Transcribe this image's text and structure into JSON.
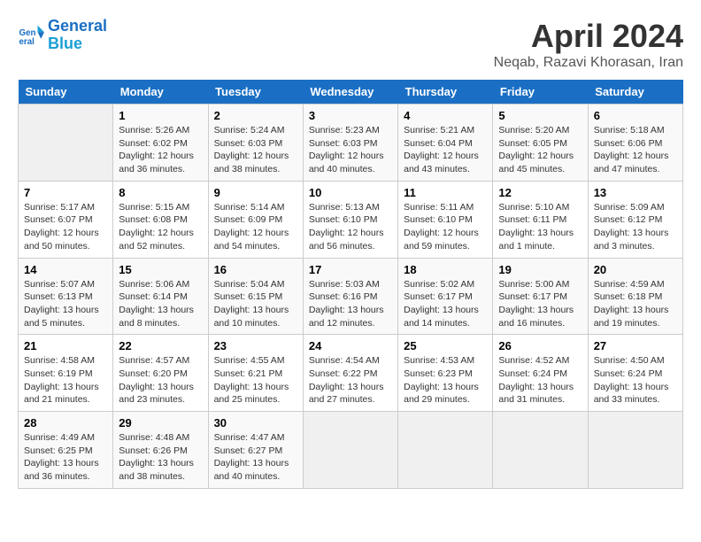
{
  "header": {
    "logo_line1": "General",
    "logo_line2": "Blue",
    "title": "April 2024",
    "subtitle": "Neqab, Razavi Khorasan, Iran"
  },
  "weekdays": [
    "Sunday",
    "Monday",
    "Tuesday",
    "Wednesday",
    "Thursday",
    "Friday",
    "Saturday"
  ],
  "weeks": [
    [
      {
        "day": "",
        "info": ""
      },
      {
        "day": "1",
        "info": "Sunrise: 5:26 AM\nSunset: 6:02 PM\nDaylight: 12 hours\nand 36 minutes."
      },
      {
        "day": "2",
        "info": "Sunrise: 5:24 AM\nSunset: 6:03 PM\nDaylight: 12 hours\nand 38 minutes."
      },
      {
        "day": "3",
        "info": "Sunrise: 5:23 AM\nSunset: 6:03 PM\nDaylight: 12 hours\nand 40 minutes."
      },
      {
        "day": "4",
        "info": "Sunrise: 5:21 AM\nSunset: 6:04 PM\nDaylight: 12 hours\nand 43 minutes."
      },
      {
        "day": "5",
        "info": "Sunrise: 5:20 AM\nSunset: 6:05 PM\nDaylight: 12 hours\nand 45 minutes."
      },
      {
        "day": "6",
        "info": "Sunrise: 5:18 AM\nSunset: 6:06 PM\nDaylight: 12 hours\nand 47 minutes."
      }
    ],
    [
      {
        "day": "7",
        "info": "Sunrise: 5:17 AM\nSunset: 6:07 PM\nDaylight: 12 hours\nand 50 minutes."
      },
      {
        "day": "8",
        "info": "Sunrise: 5:15 AM\nSunset: 6:08 PM\nDaylight: 12 hours\nand 52 minutes."
      },
      {
        "day": "9",
        "info": "Sunrise: 5:14 AM\nSunset: 6:09 PM\nDaylight: 12 hours\nand 54 minutes."
      },
      {
        "day": "10",
        "info": "Sunrise: 5:13 AM\nSunset: 6:10 PM\nDaylight: 12 hours\nand 56 minutes."
      },
      {
        "day": "11",
        "info": "Sunrise: 5:11 AM\nSunset: 6:10 PM\nDaylight: 12 hours\nand 59 minutes."
      },
      {
        "day": "12",
        "info": "Sunrise: 5:10 AM\nSunset: 6:11 PM\nDaylight: 13 hours\nand 1 minute."
      },
      {
        "day": "13",
        "info": "Sunrise: 5:09 AM\nSunset: 6:12 PM\nDaylight: 13 hours\nand 3 minutes."
      }
    ],
    [
      {
        "day": "14",
        "info": "Sunrise: 5:07 AM\nSunset: 6:13 PM\nDaylight: 13 hours\nand 5 minutes."
      },
      {
        "day": "15",
        "info": "Sunrise: 5:06 AM\nSunset: 6:14 PM\nDaylight: 13 hours\nand 8 minutes."
      },
      {
        "day": "16",
        "info": "Sunrise: 5:04 AM\nSunset: 6:15 PM\nDaylight: 13 hours\nand 10 minutes."
      },
      {
        "day": "17",
        "info": "Sunrise: 5:03 AM\nSunset: 6:16 PM\nDaylight: 13 hours\nand 12 minutes."
      },
      {
        "day": "18",
        "info": "Sunrise: 5:02 AM\nSunset: 6:17 PM\nDaylight: 13 hours\nand 14 minutes."
      },
      {
        "day": "19",
        "info": "Sunrise: 5:00 AM\nSunset: 6:17 PM\nDaylight: 13 hours\nand 16 minutes."
      },
      {
        "day": "20",
        "info": "Sunrise: 4:59 AM\nSunset: 6:18 PM\nDaylight: 13 hours\nand 19 minutes."
      }
    ],
    [
      {
        "day": "21",
        "info": "Sunrise: 4:58 AM\nSunset: 6:19 PM\nDaylight: 13 hours\nand 21 minutes."
      },
      {
        "day": "22",
        "info": "Sunrise: 4:57 AM\nSunset: 6:20 PM\nDaylight: 13 hours\nand 23 minutes."
      },
      {
        "day": "23",
        "info": "Sunrise: 4:55 AM\nSunset: 6:21 PM\nDaylight: 13 hours\nand 25 minutes."
      },
      {
        "day": "24",
        "info": "Sunrise: 4:54 AM\nSunset: 6:22 PM\nDaylight: 13 hours\nand 27 minutes."
      },
      {
        "day": "25",
        "info": "Sunrise: 4:53 AM\nSunset: 6:23 PM\nDaylight: 13 hours\nand 29 minutes."
      },
      {
        "day": "26",
        "info": "Sunrise: 4:52 AM\nSunset: 6:24 PM\nDaylight: 13 hours\nand 31 minutes."
      },
      {
        "day": "27",
        "info": "Sunrise: 4:50 AM\nSunset: 6:24 PM\nDaylight: 13 hours\nand 33 minutes."
      }
    ],
    [
      {
        "day": "28",
        "info": "Sunrise: 4:49 AM\nSunset: 6:25 PM\nDaylight: 13 hours\nand 36 minutes."
      },
      {
        "day": "29",
        "info": "Sunrise: 4:48 AM\nSunset: 6:26 PM\nDaylight: 13 hours\nand 38 minutes."
      },
      {
        "day": "30",
        "info": "Sunrise: 4:47 AM\nSunset: 6:27 PM\nDaylight: 13 hours\nand 40 minutes."
      },
      {
        "day": "",
        "info": ""
      },
      {
        "day": "",
        "info": ""
      },
      {
        "day": "",
        "info": ""
      },
      {
        "day": "",
        "info": ""
      }
    ]
  ]
}
